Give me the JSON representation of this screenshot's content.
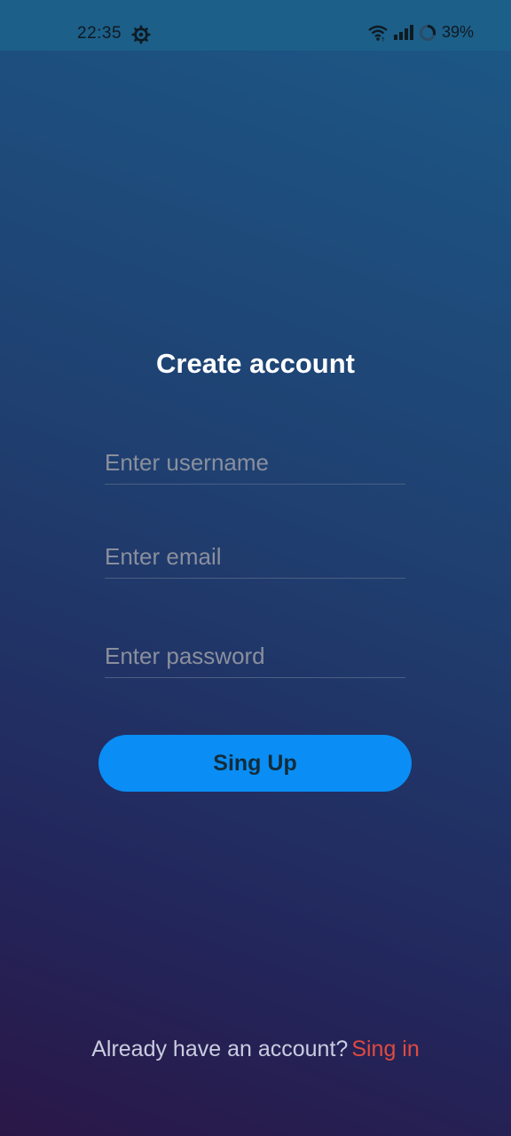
{
  "status_bar": {
    "time": "22:35",
    "battery": "39%",
    "icons": [
      "settings-icon",
      "wifi-icon",
      "signal-icon",
      "battery-icon"
    ]
  },
  "screen": {
    "title": "Create account",
    "username_placeholder": "Enter username",
    "email_placeholder": "Enter email",
    "password_placeholder": "Enter password",
    "signup_label": "Sing Up",
    "footer_text": "Already have an account?",
    "signin_link": "Sing in"
  },
  "colors": {
    "button": "#0a8ef5",
    "link": "#e04a3f",
    "status_bar": "#1c5f89"
  }
}
